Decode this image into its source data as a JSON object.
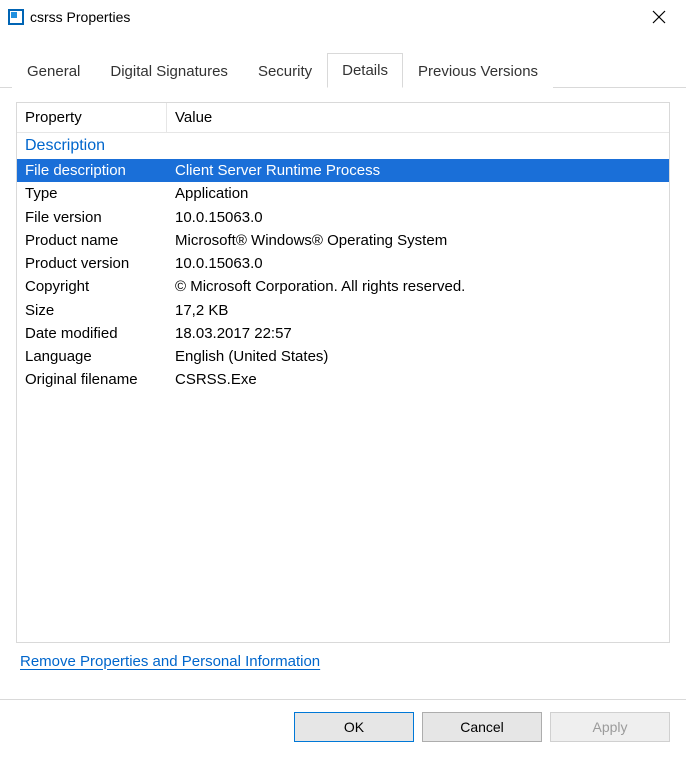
{
  "window": {
    "title": "csrss Properties"
  },
  "tabs": [
    {
      "label": "General"
    },
    {
      "label": "Digital Signatures"
    },
    {
      "label": "Security"
    },
    {
      "label": "Details",
      "active": true
    },
    {
      "label": "Previous Versions"
    }
  ],
  "grid": {
    "columns": {
      "property": "Property",
      "value": "Value"
    },
    "section": "Description",
    "rows": [
      {
        "property": "File description",
        "value": "Client Server Runtime Process",
        "selected": true
      },
      {
        "property": "Type",
        "value": "Application"
      },
      {
        "property": "File version",
        "value": "10.0.15063.0"
      },
      {
        "property": "Product name",
        "value": "Microsoft® Windows® Operating System"
      },
      {
        "property": "Product version",
        "value": "10.0.15063.0"
      },
      {
        "property": "Copyright",
        "value": "© Microsoft Corporation. All rights reserved."
      },
      {
        "property": "Size",
        "value": "17,2 KB"
      },
      {
        "property": "Date modified",
        "value": "18.03.2017 22:57"
      },
      {
        "property": "Language",
        "value": "English (United States)"
      },
      {
        "property": "Original filename",
        "value": "CSRSS.Exe"
      }
    ]
  },
  "link": "Remove Properties and Personal Information",
  "buttons": {
    "ok": "OK",
    "cancel": "Cancel",
    "apply": "Apply"
  }
}
